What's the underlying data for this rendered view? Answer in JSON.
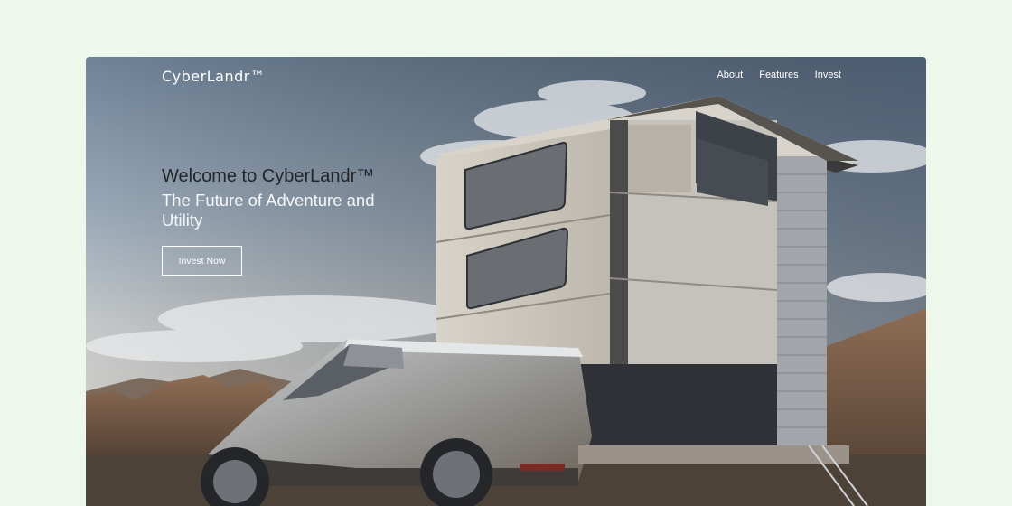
{
  "brand": {
    "logo_text": "CyberLandr™"
  },
  "nav": {
    "items": [
      {
        "label": "About"
      },
      {
        "label": "Features"
      },
      {
        "label": "Invest"
      }
    ]
  },
  "hero": {
    "title": "Welcome to CyberLandr™",
    "subtitle": "The Future of Adventure and Utility",
    "cta_label": "Invest Now"
  },
  "colors": {
    "page_background": "#eef7ec",
    "hero_title": "#222629",
    "hero_subtitle": "#f4f6f8",
    "nav_text": "#ffffff"
  }
}
